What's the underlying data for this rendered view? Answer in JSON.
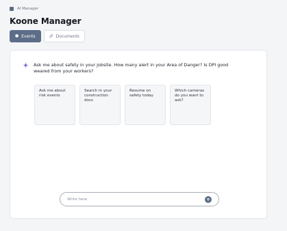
{
  "breadcrumb": {
    "label": "AI Manager"
  },
  "page": {
    "title": "Koone Manager"
  },
  "tabs": [
    {
      "label": "Events",
      "icon": "dot-icon",
      "active": true
    },
    {
      "label": "Documents",
      "icon": "paperclip-icon",
      "active": false
    }
  ],
  "chat": {
    "prompt": "Ask me about safety in your jobsite. How many alert in your Area of Danger? Is DPI good weared from your workers?",
    "suggestions": [
      {
        "label": "Ask me about risk events"
      },
      {
        "label": "Search in your construction docs"
      },
      {
        "label": "Resume on safety today"
      },
      {
        "label": "Which cameras do you want to ask?"
      }
    ],
    "input": {
      "placeholder": "Write here",
      "value": ""
    }
  },
  "colors": {
    "accent": "#5c6d87",
    "sparkle": "#7c6cd6",
    "background": "#f4f5f7"
  }
}
